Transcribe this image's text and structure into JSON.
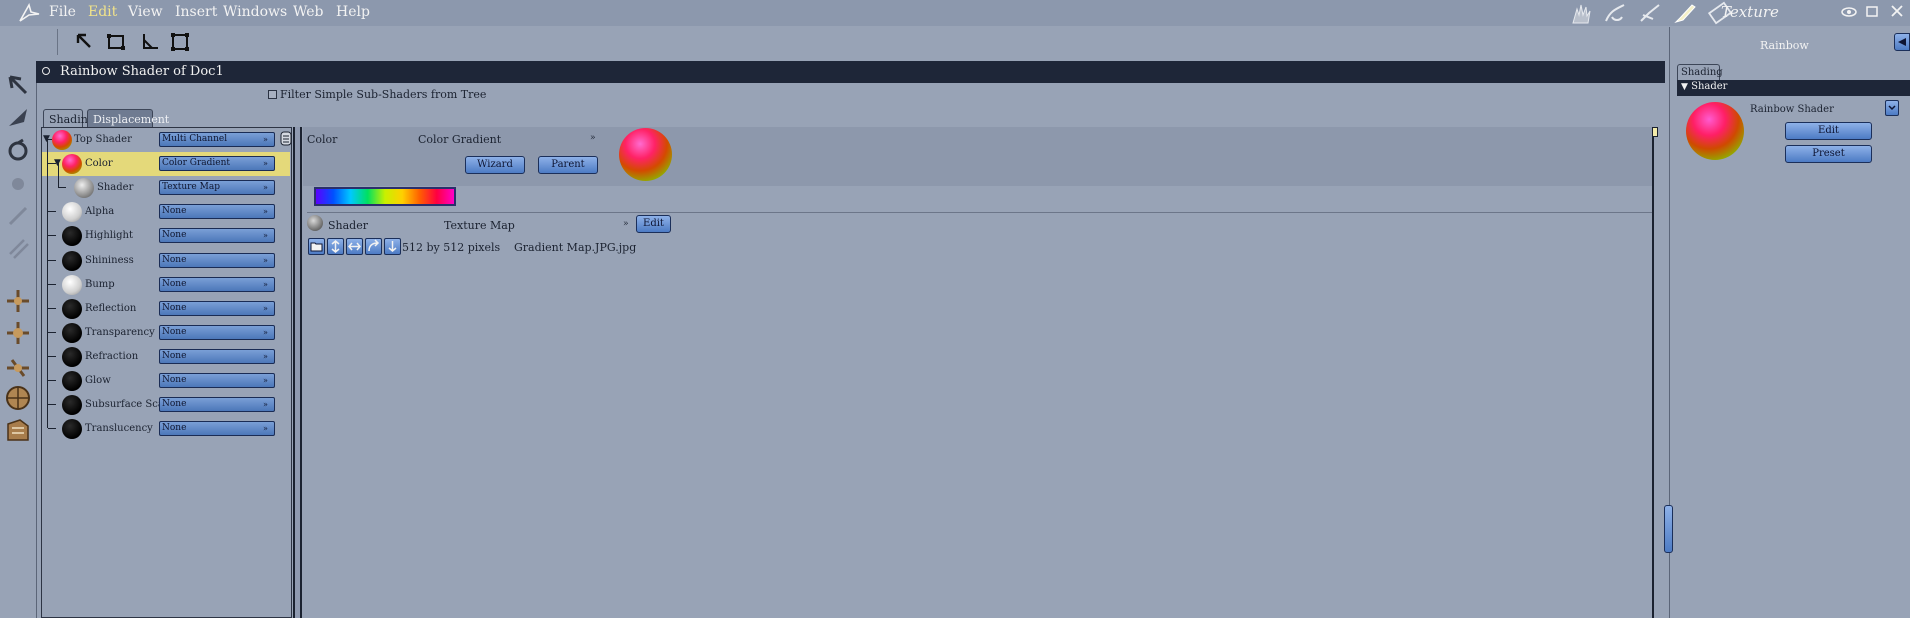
{
  "menu": {
    "items": [
      "File",
      "Edit",
      "View",
      "Insert",
      "Windows",
      "Web",
      "Help"
    ],
    "active_index": 1
  },
  "room": {
    "title": "Texture"
  },
  "panel": {
    "title": "Rainbow Shader of Doc1",
    "filter_label": "Filter Simple Sub-Shaders from Tree",
    "tabs": [
      "Shading",
      "Displacement"
    ],
    "selected_tab": "Shading"
  },
  "tree": {
    "rows": [
      {
        "label": "Top Shader",
        "value": "Multi Channel",
        "ball": "rainbow"
      },
      {
        "label": "Color",
        "value": "Color Gradient",
        "ball": "rainbow"
      },
      {
        "label": "Shader",
        "value": "Texture Map",
        "ball": "grey"
      },
      {
        "label": "Alpha",
        "value": "None",
        "ball": "white"
      },
      {
        "label": "Highlight",
        "value": "None",
        "ball": "black"
      },
      {
        "label": "Shininess",
        "value": "None",
        "ball": "black"
      },
      {
        "label": "Bump",
        "value": "None",
        "ball": "white"
      },
      {
        "label": "Reflection",
        "value": "None",
        "ball": "black"
      },
      {
        "label": "Transparency",
        "value": "None",
        "ball": "black"
      },
      {
        "label": "Refraction",
        "value": "None",
        "ball": "black"
      },
      {
        "label": "Glow",
        "value": "None",
        "ball": "black"
      },
      {
        "label": "Subsurface Scat",
        "value": "None",
        "ball": "black"
      },
      {
        "label": "Translucency",
        "value": "None",
        "ball": "black"
      }
    ],
    "selected_index": 1
  },
  "editor": {
    "channel_label": "Color",
    "channel_value": "Color Gradient",
    "wizard_label": "Wizard",
    "parent_label": "Parent",
    "sub_label": "Shader",
    "sub_value": "Texture Map",
    "edit_label": "Edit",
    "texture_size": "512 by 512 pixels",
    "texture_file": "Gradient Map.JPG.jpg"
  },
  "right_panel": {
    "title": "Rainbow",
    "tab": "Shading",
    "section": "Shader",
    "shader_name": "Rainbow Shader",
    "edit_label": "Edit",
    "preset_label": "Preset"
  },
  "colors": {
    "background": "#98a3b6",
    "title_bar": "#1e2638",
    "selection": "#e4d97a",
    "button_blue": "#6b93d4"
  }
}
